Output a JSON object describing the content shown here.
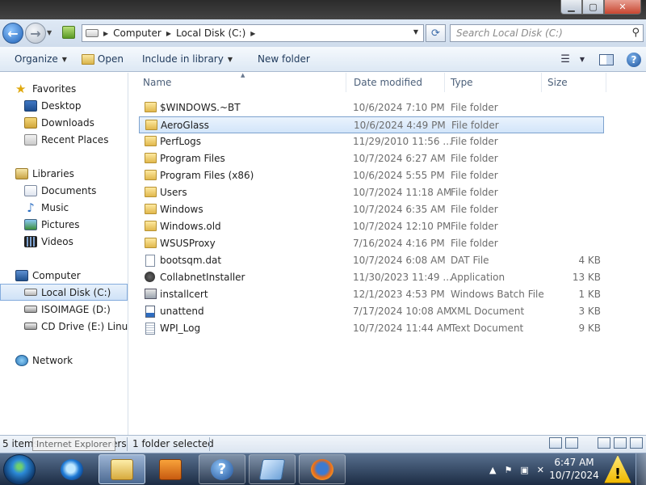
{
  "window": {
    "minimize_icon": "minimize-icon",
    "maximize_icon": "maximize-icon",
    "close_icon": "close-icon"
  },
  "address": {
    "crumbs": [
      "Computer",
      "Local Disk (C:)"
    ],
    "search_placeholder": "Search Local Disk (C:)"
  },
  "toolbar": {
    "organize": "Organize",
    "open": "Open",
    "include_in_library": "Include in library",
    "new_folder": "New folder"
  },
  "nav": {
    "favorites": "Favorites",
    "desktop": "Desktop",
    "downloads": "Downloads",
    "recent_places": "Recent Places",
    "libraries": "Libraries",
    "documents": "Documents",
    "music": "Music",
    "pictures": "Pictures",
    "videos": "Videos",
    "computer": "Computer",
    "local_disk": "Local Disk (C:)",
    "isoimage": "ISOIMAGE (D:)",
    "cd_drive": "CD Drive (E:) Linux M",
    "network": "Network"
  },
  "columns": {
    "name": "Name",
    "date_modified": "Date modified",
    "type": "Type",
    "size": "Size"
  },
  "files": [
    {
      "name": "$WINDOWS.~BT",
      "date": "10/6/2024 7:10 PM",
      "type": "File folder",
      "size": "",
      "icon": "folder"
    },
    {
      "name": "AeroGlass",
      "date": "10/6/2024 4:49 PM",
      "type": "File folder",
      "size": "",
      "icon": "folder",
      "selected": true
    },
    {
      "name": "PerfLogs",
      "date": "11/29/2010 11:56 ...",
      "type": "File folder",
      "size": "",
      "icon": "folder"
    },
    {
      "name": "Program Files",
      "date": "10/7/2024 6:27 AM",
      "type": "File folder",
      "size": "",
      "icon": "folder"
    },
    {
      "name": "Program Files (x86)",
      "date": "10/6/2024 5:55 PM",
      "type": "File folder",
      "size": "",
      "icon": "folder"
    },
    {
      "name": "Users",
      "date": "10/7/2024 11:18 AM",
      "type": "File folder",
      "size": "",
      "icon": "folder"
    },
    {
      "name": "Windows",
      "date": "10/7/2024 6:35 AM",
      "type": "File folder",
      "size": "",
      "icon": "folder"
    },
    {
      "name": "Windows.old",
      "date": "10/7/2024 12:10 PM",
      "type": "File folder",
      "size": "",
      "icon": "folder"
    },
    {
      "name": "WSUSProxy",
      "date": "7/16/2024 4:16 PM",
      "type": "File folder",
      "size": "",
      "icon": "folder"
    },
    {
      "name": "bootsqm.dat",
      "date": "10/7/2024 6:08 AM",
      "type": "DAT File",
      "size": "4 KB",
      "icon": "file"
    },
    {
      "name": "CollabnetInstaller",
      "date": "11/30/2023 11:49 ...",
      "type": "Application",
      "size": "13 KB",
      "icon": "app"
    },
    {
      "name": "installcert",
      "date": "12/1/2023 4:53 PM",
      "type": "Windows Batch File",
      "size": "1 KB",
      "icon": "bat"
    },
    {
      "name": "unattend",
      "date": "7/17/2024 10:08 AM",
      "type": "XML Document",
      "size": "3 KB",
      "icon": "xml"
    },
    {
      "name": "WPI_Log",
      "date": "10/7/2024 11:44 AM",
      "type": "Text Document",
      "size": "9 KB",
      "icon": "txt"
    }
  ],
  "status": {
    "items_prefix": "5 items",
    "items_suffix": "ers",
    "tooltip": "Internet Explorer",
    "selected": "1 folder selected"
  },
  "taskbar": {
    "clock_time": "6:47 AM",
    "clock_date": "10/7/2024",
    "warning_glyph": "!"
  }
}
